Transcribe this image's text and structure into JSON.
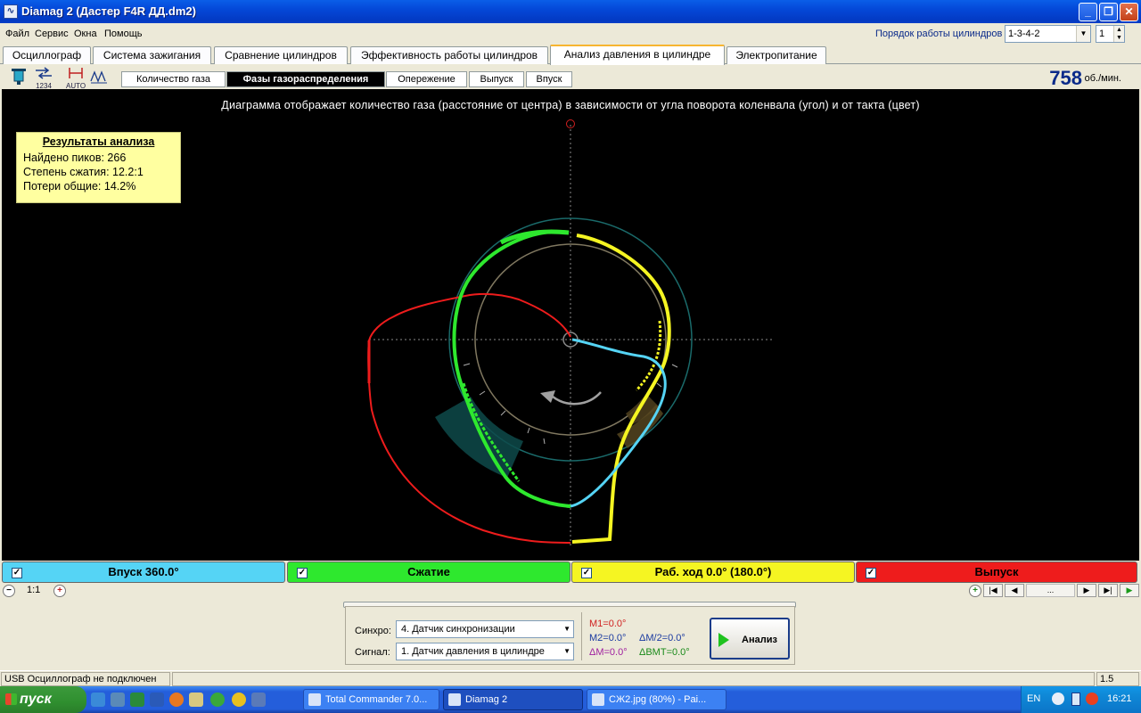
{
  "window": {
    "title": "Diamag 2 (Дастер F4R ДД.dm2)",
    "icon": "oscilloscope-icon"
  },
  "menu": [
    "Файл",
    "Сервис",
    "Окна",
    "Помощь"
  ],
  "cylinder_order": {
    "label": "Порядок работы цилиндров",
    "value": "1-3-4-2",
    "count": "1"
  },
  "main_tabs": [
    "Осциллограф",
    "Система зажигания",
    "Сравнение цилиндров",
    "Эффективность работы цилиндров",
    "Анализ давления в цилиндре",
    "Электропитание"
  ],
  "main_tab_active": "Анализ давления в цилиндре",
  "sub_tabs": [
    "Количество газа",
    "Фазы газораспределения",
    "Опережение",
    "Выпуск",
    "Впуск"
  ],
  "sub_tab_active": "Фазы газораспределения",
  "toolbar_icons": [
    "cylinder-icon",
    "transfer-icon",
    "auto-scale-icon",
    "waveform-icon"
  ],
  "toolbar_texts": {
    "auto": "AUTO",
    "n1234": "1234"
  },
  "rpm": {
    "value": "758",
    "unit": "об./мин."
  },
  "diagram": {
    "caption": "Диаграмма отображает количество газа (расстояние от центра) в зависимости от угла поворота коленвала (угол) и от такта (цвет)",
    "colors": {
      "intake": "#55d4f5",
      "compression": "#2ee82e",
      "power": "#f5f522",
      "exhaust": "#ee1c1c",
      "axis": "#8a8a8a",
      "ring": "#1a6a6a",
      "inner_ring": "#807860"
    }
  },
  "results": {
    "heading": "Результаты анализа",
    "peaks": "Найдено пиков: 266",
    "compression": "Степень сжатия: 12.2:1",
    "losses": "Потери общие: 14.2%"
  },
  "legend": [
    {
      "label": "Впуск 360.0°",
      "color": "#55d4f5",
      "checked": true
    },
    {
      "label": "Сжатие",
      "color": "#2ee82e",
      "checked": true
    },
    {
      "label": "Раб. ход 0.0° (180.0°)",
      "color": "#f5f522",
      "checked": true
    },
    {
      "label": "Выпуск",
      "color": "#ee1c1c",
      "checked": true
    }
  ],
  "zoom": {
    "value": "1:1",
    "nav_dots": "..."
  },
  "analysis_panel": {
    "sync_label": "Синхро:",
    "sync_value": "4.  Датчик синхронизации",
    "signal_label": "Сигнал:",
    "signal_value": "1.  Датчик давления в цилиндре",
    "m1": "M1=0.0°",
    "m2": "M2=0.0°",
    "dm": "ΔM=0.0°",
    "dm2": "ΔM/2=0.0°",
    "dbmt": "ΔBMT=0.0°",
    "analyze_label": "Анализ"
  },
  "status": {
    "left": "USB Осциллограф не подключен",
    "right": "1.5"
  },
  "taskbar": {
    "start": "пуск",
    "tasks": [
      "Total Commander 7.0...",
      "Diamag 2",
      "СЖ2.jpg (80%) - Pai..."
    ],
    "active_task": "Diamag 2",
    "lang": "EN",
    "clock": "16:21"
  }
}
